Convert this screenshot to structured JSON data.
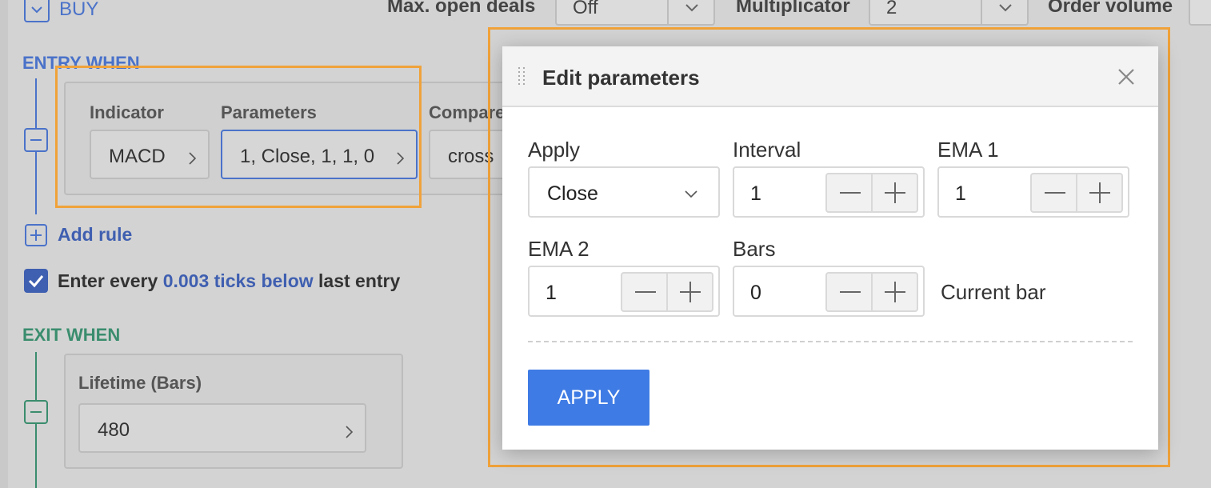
{
  "background": {
    "buy_label": "BUY",
    "max_open_deals_label": "Max. open deals",
    "max_open_deals_value": "Off",
    "multiplicator_label": "Multiplicator",
    "multiplicator_value": "2",
    "order_volume_label": "Order volume",
    "entry_title": "ENTRY WHEN",
    "exit_title": "EXIT WHEN",
    "rule": {
      "indicator_label": "Indicator",
      "indicator_value": "MACD",
      "parameters_label": "Parameters",
      "parameters_value": "1, Close, 1, 1, 0",
      "compare_label": "Compare",
      "compare_value": "cross"
    },
    "add_rule": "Add rule",
    "enter_every_prefix": "Enter every ",
    "enter_every_link": "0.003 ticks below",
    "enter_every_suffix": " last entry",
    "lifetime_label": "Lifetime (Bars)",
    "lifetime_value": "480"
  },
  "modal": {
    "title": "Edit parameters",
    "apply": {
      "label": "Apply",
      "value": "Close"
    },
    "interval": {
      "label": "Interval",
      "value": "1"
    },
    "ema1": {
      "label": "EMA 1",
      "value": "1"
    },
    "ema2": {
      "label": "EMA 2",
      "value": "1"
    },
    "bars": {
      "label": "Bars",
      "value": "0"
    },
    "current_bar": "Current bar",
    "apply_button": "APPLY"
  },
  "colors": {
    "highlight": "#f0a23a",
    "primary_button": "#3f7be4",
    "entry_accent": "#4a72c9",
    "exit_accent": "#3a8d6e"
  }
}
